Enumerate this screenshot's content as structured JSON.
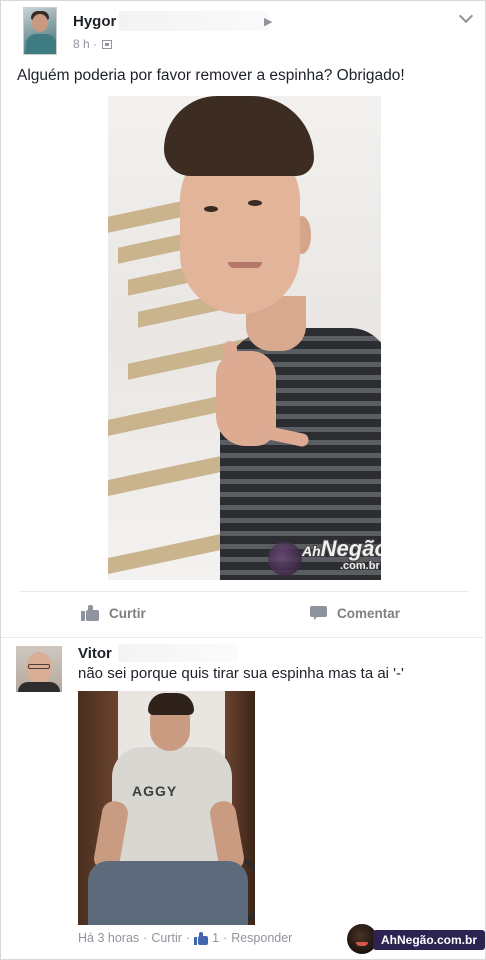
{
  "post": {
    "author": "Hygor",
    "time": "8 h",
    "separator": "·",
    "text": "Alguém poderia por favor remover a espinha? Obrigado!"
  },
  "watermark": {
    "prefix": "Ah",
    "brand": "Negão!",
    "suffix": ".com.br"
  },
  "actions": {
    "like": "Curtir",
    "comment": "Comentar"
  },
  "comment": {
    "author": "Vitor",
    "text": "não sei porque quis tirar sua espinha mas ta ai '-'",
    "shirt_print": "AGGY",
    "time": "Há 3 horas",
    "like": "Curtir",
    "like_count": "1",
    "reply": "Responder",
    "sep": "·"
  },
  "badge": {
    "text": "AhNegão.com.br"
  },
  "colors": {
    "meta_gray": "#90949c",
    "text": "#1d2129",
    "like_blue": "#4267b2",
    "badge_bg": "#2c2350"
  },
  "icons": [
    "chevron-down-icon",
    "globe-icon",
    "arrow-right-icon",
    "like-icon",
    "comment-icon",
    "mini-like-icon"
  ]
}
